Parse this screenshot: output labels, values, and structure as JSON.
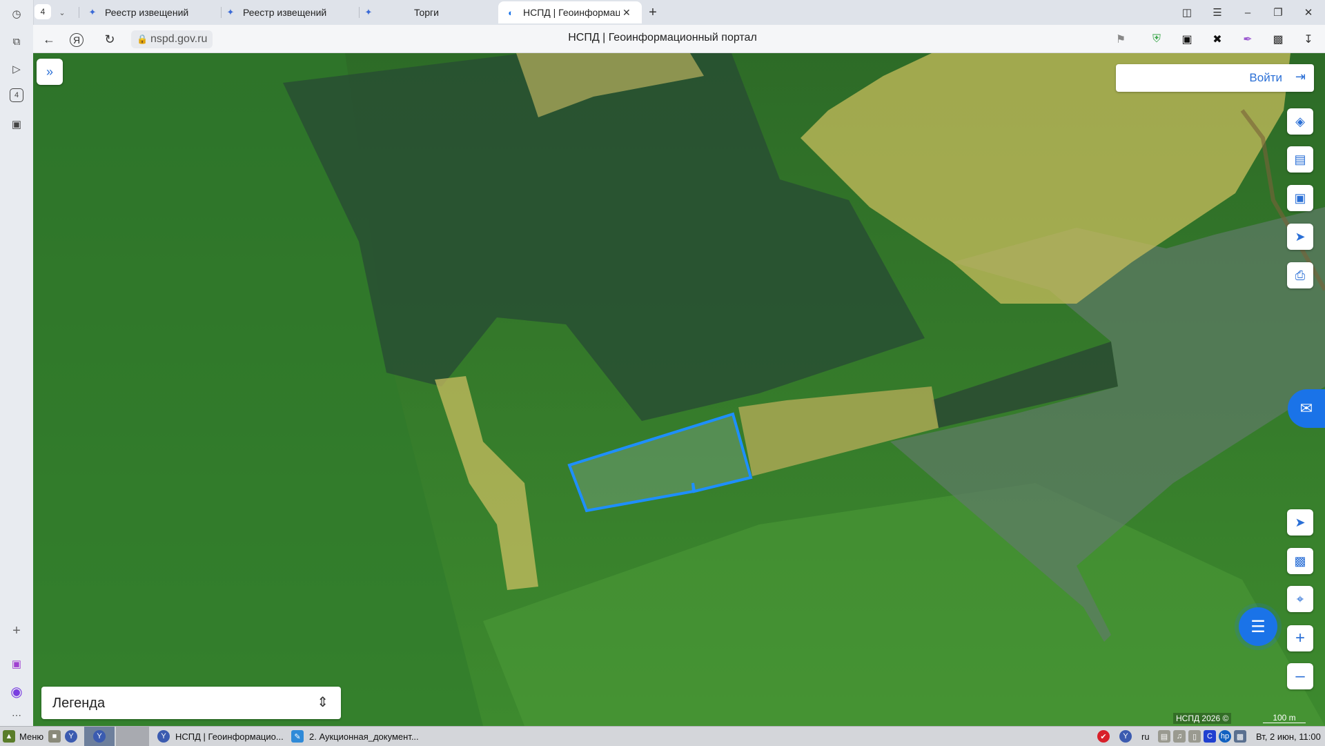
{
  "browser": {
    "tab_count": "4",
    "tabs": [
      {
        "label": "Реестр извещений"
      },
      {
        "label": "Реестр извещений"
      },
      {
        "label": "Торги"
      },
      {
        "label": "НСПД | Геоинформаци"
      }
    ],
    "url": "nspd.gov.ru",
    "page_title": "НСПД | Геоинформационный портал"
  },
  "left_rail": {
    "badge": "4"
  },
  "map": {
    "login_label": "Войти",
    "legend_label": "Легенда",
    "copyright": "НСПД 2026 ©",
    "scale_label": "100 m"
  },
  "taskbar": {
    "menu_label": "Меню",
    "windows": [
      {
        "label": "НСПД | Геоинформацио..."
      },
      {
        "label": "2. Аукционная_документ..."
      }
    ],
    "lang": "ru",
    "clock": "Вт, 2 июн, 11:00"
  },
  "colors": {
    "accent": "#1a73e8",
    "parcel_outline": "#1e8fff",
    "farmland_overlay": "#d6c96a"
  }
}
